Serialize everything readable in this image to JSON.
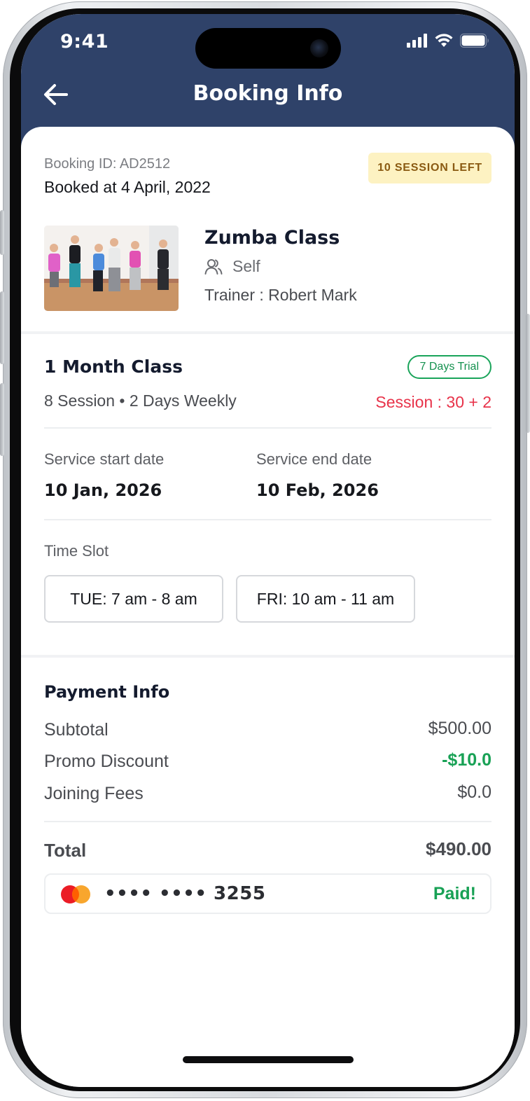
{
  "status_bar": {
    "time": "9:41"
  },
  "header": {
    "title": "Booking Info",
    "background_color": "#2f4269"
  },
  "booking": {
    "id_label": "Booking ID: AD2512",
    "booked_at": "Booked at 4 April, 2022",
    "sessions_left_badge": "10 SESSION LEFT"
  },
  "class": {
    "name": "Zumba Class",
    "participant": "Self",
    "trainer": "Trainer : Robert Mark"
  },
  "plan": {
    "title": "1 Month Class",
    "trial_badge": "7 Days Trial",
    "session_info": "8 Session • 2 Days Weekly",
    "session_count": "Session : 30 + 2"
  },
  "dates": {
    "start_label": "Service start date",
    "start_value": "10 Jan, 2026",
    "end_label": "Service end date",
    "end_value": "10 Feb, 2026"
  },
  "time_slot": {
    "label": "Time Slot",
    "slots": [
      {
        "day": "TUE",
        "time": " : 7 am - 8 am"
      },
      {
        "day": "FRI",
        "time": " : 10 am - 11 am"
      }
    ]
  },
  "payment": {
    "title": "Payment Info",
    "rows": [
      {
        "label": "Subtotal",
        "value": "$500.00",
        "color": "#4a4c51"
      },
      {
        "label": "Promo Discount",
        "value": "-$10.0",
        "color": "#18a155"
      },
      {
        "label": "Joining Fees",
        "value": "$0.0",
        "color": "#4a4c51"
      }
    ],
    "total_label": "Total",
    "total_value": "$490.00",
    "card_number": "•••• •••• 3255",
    "card_icon": "mastercard-icon",
    "status": "Paid!",
    "status_color": "#18a155"
  },
  "colors": {
    "accent_green": "#18a155",
    "accent_red": "#e8334a",
    "badge_yellow": "#fdf2c2"
  }
}
